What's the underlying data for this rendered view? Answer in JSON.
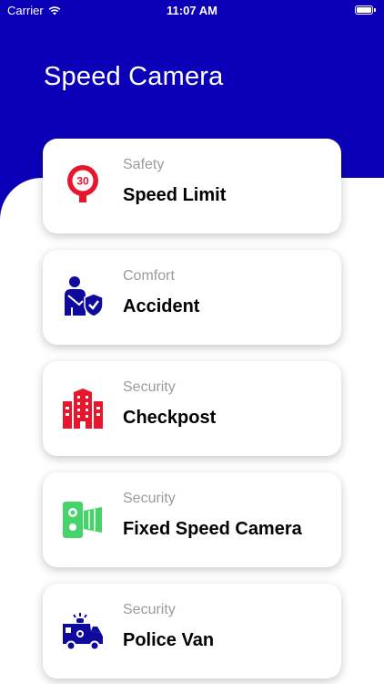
{
  "status_bar": {
    "carrier": "Carrier",
    "time": "11:07 AM"
  },
  "header": {
    "title": "Speed Camera"
  },
  "colors": {
    "brand": "#0b00b8",
    "red": "#e8162c",
    "green": "#46d36a",
    "navy": "#0f0a9e"
  },
  "cards": [
    {
      "category": "Safety",
      "title": "Speed Limit",
      "icon": "speed-limit-sign-icon",
      "sign_text": "30"
    },
    {
      "category": "Comfort",
      "title": "Accident",
      "icon": "injured-person-shield-icon"
    },
    {
      "category": "Security",
      "title": "Checkpost",
      "icon": "building-icon"
    },
    {
      "category": "Security",
      "title": "Fixed Speed Camera",
      "icon": "speed-camera-icon"
    },
    {
      "category": "Security",
      "title": "Police Van",
      "icon": "police-van-icon"
    }
  ]
}
